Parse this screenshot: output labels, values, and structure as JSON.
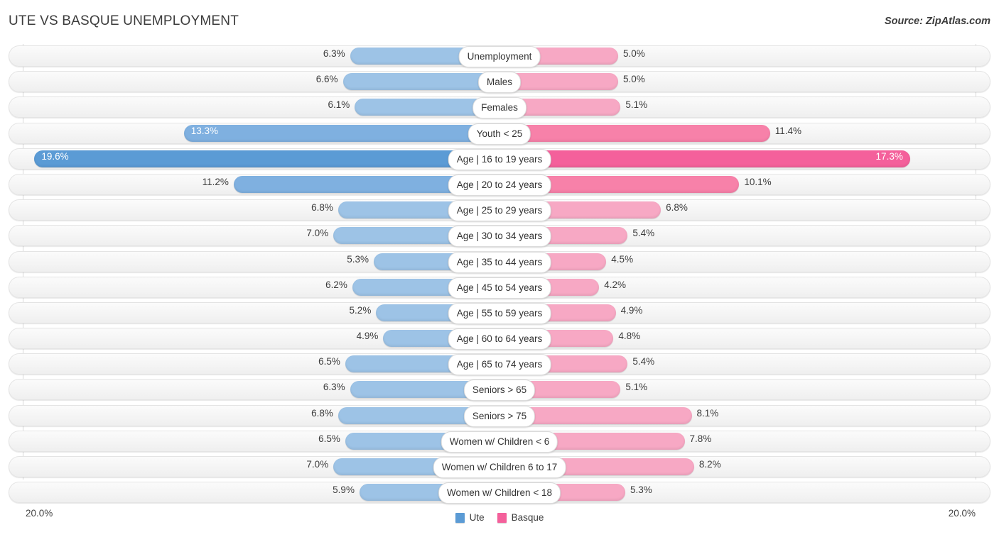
{
  "header": {
    "title": "UTE VS BASQUE UNEMPLOYMENT",
    "source": "Source: ZipAtlas.com"
  },
  "axis": {
    "left_max_label": "20.0%",
    "right_max_label": "20.0%"
  },
  "legend": {
    "items": [
      {
        "label": "Ute",
        "color": "#5B9BD5"
      },
      {
        "label": "Basque",
        "color": "#F4609B"
      }
    ]
  },
  "colors": {
    "ute_light": "#9DC3E6",
    "ute_mid": "#7FB0E0",
    "ute_strong": "#5B9BD5",
    "basque_light": "#F7A8C4",
    "basque_mid": "#F781A9",
    "basque_strong": "#F4609B",
    "track": "#F4F4F4",
    "gridline": "#D8D8D8"
  },
  "chart_data": {
    "type": "bar",
    "subtype": "diverging-bidirectional",
    "title": "UTE VS BASQUE UNEMPLOYMENT",
    "source": "Source: ZipAtlas.com",
    "xlabel": "",
    "ylabel": "",
    "unit": "%",
    "axis_max": 20.0,
    "xlim": [
      20.0,
      20.0
    ],
    "grid": true,
    "legend_position": "bottom-center",
    "categories": [
      "Unemployment",
      "Males",
      "Females",
      "Youth < 25",
      "Age | 16 to 19 years",
      "Age | 20 to 24 years",
      "Age | 25 to 29 years",
      "Age | 30 to 34 years",
      "Age | 35 to 44 years",
      "Age | 45 to 54 years",
      "Age | 55 to 59 years",
      "Age | 60 to 64 years",
      "Age | 65 to 74 years",
      "Seniors > 65",
      "Seniors > 75",
      "Women w/ Children < 6",
      "Women w/ Children 6 to 17",
      "Women w/ Children < 18"
    ],
    "series": [
      {
        "name": "Ute",
        "side": "left",
        "color": "#5B9BD5",
        "values": [
          6.3,
          6.6,
          6.1,
          13.3,
          19.6,
          11.2,
          6.8,
          7.0,
          5.3,
          6.2,
          5.2,
          4.9,
          6.5,
          6.3,
          6.8,
          6.5,
          7.0,
          5.9
        ],
        "labels": [
          "6.3%",
          "6.6%",
          "6.1%",
          "13.3%",
          "19.6%",
          "11.2%",
          "6.8%",
          "7.0%",
          "5.3%",
          "6.2%",
          "5.2%",
          "4.9%",
          "6.5%",
          "6.3%",
          "6.8%",
          "6.5%",
          "7.0%",
          "5.9%"
        ]
      },
      {
        "name": "Basque",
        "side": "right",
        "color": "#F4609B",
        "values": [
          5.0,
          5.0,
          5.1,
          11.4,
          17.3,
          10.1,
          6.8,
          5.4,
          4.5,
          4.2,
          4.9,
          4.8,
          5.4,
          5.1,
          8.1,
          7.8,
          8.2,
          5.3
        ],
        "labels": [
          "5.0%",
          "5.0%",
          "5.1%",
          "11.4%",
          "17.3%",
          "10.1%",
          "6.8%",
          "5.4%",
          "4.5%",
          "4.2%",
          "4.9%",
          "4.8%",
          "5.4%",
          "5.1%",
          "8.1%",
          "7.8%",
          "8.2%",
          "5.3%"
        ]
      }
    ],
    "rows": [
      {
        "label": "Unemployment",
        "ute": 6.3,
        "ute_label": "6.3%",
        "basque": 5.0,
        "basque_label": "5.0%",
        "emphasis": "light"
      },
      {
        "label": "Males",
        "ute": 6.6,
        "ute_label": "6.6%",
        "basque": 5.0,
        "basque_label": "5.0%",
        "emphasis": "light"
      },
      {
        "label": "Females",
        "ute": 6.1,
        "ute_label": "6.1%",
        "basque": 5.1,
        "basque_label": "5.1%",
        "emphasis": "light"
      },
      {
        "label": "Youth < 25",
        "ute": 13.3,
        "ute_label": "13.3%",
        "basque": 11.4,
        "basque_label": "11.4%",
        "emphasis": "mid",
        "ute_label_inside": true
      },
      {
        "label": "Age | 16 to 19 years",
        "ute": 19.6,
        "ute_label": "19.6%",
        "basque": 17.3,
        "basque_label": "17.3%",
        "emphasis": "strong",
        "ute_label_inside": true,
        "basque_label_inside": true
      },
      {
        "label": "Age | 20 to 24 years",
        "ute": 11.2,
        "ute_label": "11.2%",
        "basque": 10.1,
        "basque_label": "10.1%",
        "emphasis": "mid"
      },
      {
        "label": "Age | 25 to 29 years",
        "ute": 6.8,
        "ute_label": "6.8%",
        "basque": 6.8,
        "basque_label": "6.8%",
        "emphasis": "light"
      },
      {
        "label": "Age | 30 to 34 years",
        "ute": 7.0,
        "ute_label": "7.0%",
        "basque": 5.4,
        "basque_label": "5.4%",
        "emphasis": "light"
      },
      {
        "label": "Age | 35 to 44 years",
        "ute": 5.3,
        "ute_label": "5.3%",
        "basque": 4.5,
        "basque_label": "4.5%",
        "emphasis": "light"
      },
      {
        "label": "Age | 45 to 54 years",
        "ute": 6.2,
        "ute_label": "6.2%",
        "basque": 4.2,
        "basque_label": "4.2%",
        "emphasis": "light"
      },
      {
        "label": "Age | 55 to 59 years",
        "ute": 5.2,
        "ute_label": "5.2%",
        "basque": 4.9,
        "basque_label": "4.9%",
        "emphasis": "light"
      },
      {
        "label": "Age | 60 to 64 years",
        "ute": 4.9,
        "ute_label": "4.9%",
        "basque": 4.8,
        "basque_label": "4.8%",
        "emphasis": "light"
      },
      {
        "label": "Age | 65 to 74 years",
        "ute": 6.5,
        "ute_label": "6.5%",
        "basque": 5.4,
        "basque_label": "5.4%",
        "emphasis": "light"
      },
      {
        "label": "Seniors > 65",
        "ute": 6.3,
        "ute_label": "6.3%",
        "basque": 5.1,
        "basque_label": "5.1%",
        "emphasis": "light"
      },
      {
        "label": "Seniors > 75",
        "ute": 6.8,
        "ute_label": "6.8%",
        "basque": 8.1,
        "basque_label": "8.1%",
        "emphasis": "light"
      },
      {
        "label": "Women w/ Children < 6",
        "ute": 6.5,
        "ute_label": "6.5%",
        "basque": 7.8,
        "basque_label": "7.8%",
        "emphasis": "light"
      },
      {
        "label": "Women w/ Children 6 to 17",
        "ute": 7.0,
        "ute_label": "7.0%",
        "basque": 8.2,
        "basque_label": "8.2%",
        "emphasis": "light"
      },
      {
        "label": "Women w/ Children < 18",
        "ute": 5.9,
        "ute_label": "5.9%",
        "basque": 5.3,
        "basque_label": "5.3%",
        "emphasis": "light"
      }
    ]
  }
}
